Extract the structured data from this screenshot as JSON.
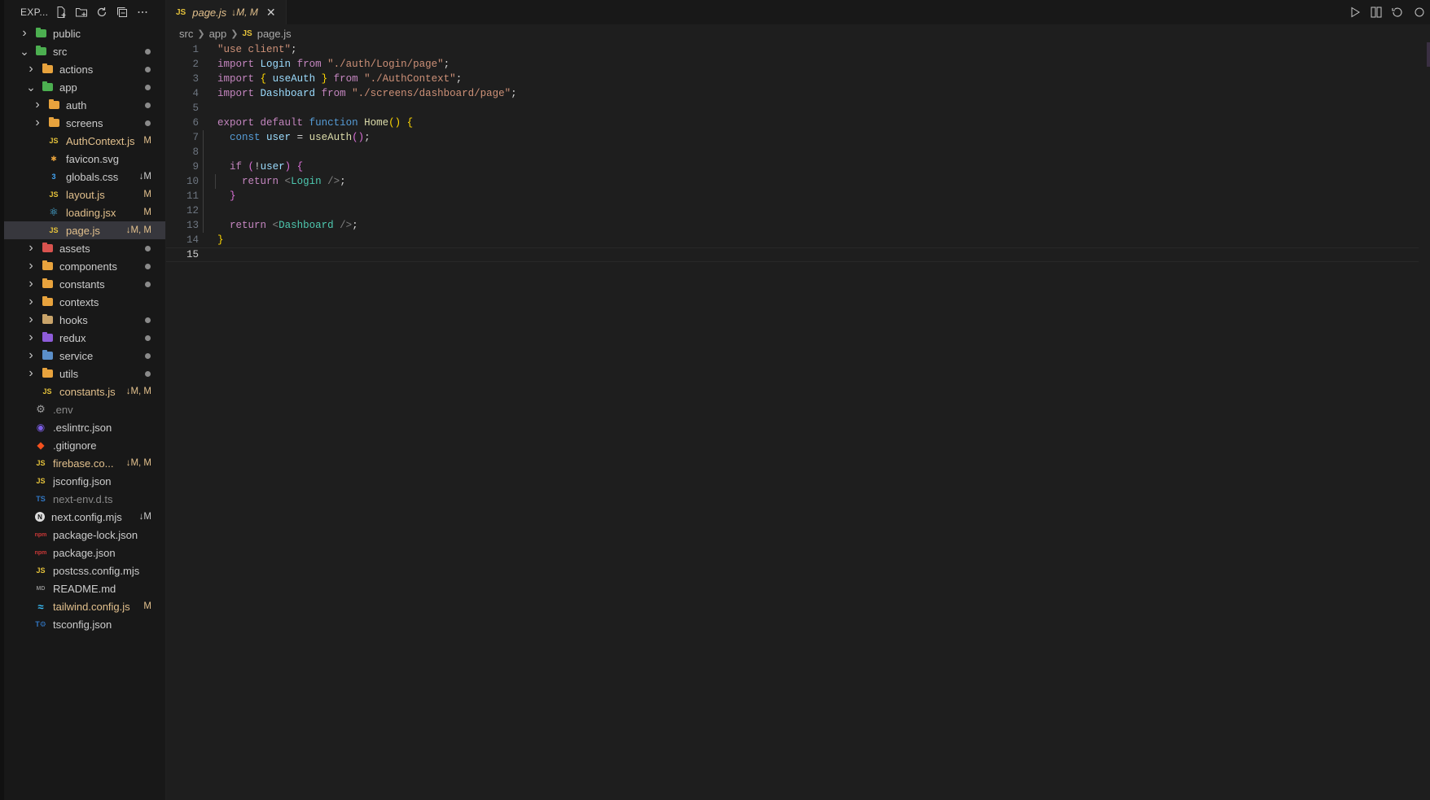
{
  "sidebar": {
    "title": "EXP...",
    "actions": [
      "new-file-icon",
      "new-folder-icon",
      "refresh-icon",
      "collapse-all-icon",
      "more-icon"
    ],
    "items": [
      {
        "name": "public",
        "depth": 0,
        "kind": "folder",
        "expanded": false,
        "color": "#4caf50",
        "badge": "",
        "dot": false
      },
      {
        "name": "src",
        "depth": 0,
        "kind": "folder",
        "expanded": true,
        "color": "#4caf50",
        "badge": "",
        "dot": true
      },
      {
        "name": "actions",
        "depth": 1,
        "kind": "folder",
        "expanded": false,
        "color": "#e8a33d",
        "badge": "",
        "dot": true
      },
      {
        "name": "app",
        "depth": 1,
        "kind": "folder",
        "expanded": true,
        "color": "#4caf50",
        "badge": "",
        "dot": true
      },
      {
        "name": "auth",
        "depth": 2,
        "kind": "folder",
        "expanded": false,
        "color": "#e8a33d",
        "badge": "",
        "dot": true
      },
      {
        "name": "screens",
        "depth": 2,
        "kind": "folder",
        "expanded": false,
        "color": "#e8a33d",
        "badge": "",
        "dot": true
      },
      {
        "name": "AuthContext.js",
        "depth": 2,
        "kind": "js",
        "badge": "M",
        "modified": true,
        "dot": false
      },
      {
        "name": "favicon.svg",
        "depth": 2,
        "kind": "svg",
        "badge": "",
        "modified": false,
        "dot": false
      },
      {
        "name": "globals.css",
        "depth": 2,
        "kind": "css",
        "badge": "↓M",
        "modified": false,
        "dot": false
      },
      {
        "name": "layout.js",
        "depth": 2,
        "kind": "js",
        "badge": "M",
        "modified": true,
        "dot": false
      },
      {
        "name": "loading.jsx",
        "depth": 2,
        "kind": "react",
        "badge": "M",
        "modified": true,
        "dot": false
      },
      {
        "name": "page.js",
        "depth": 2,
        "kind": "js",
        "badge": "↓M, M",
        "modified": true,
        "dot": false,
        "selected": true
      },
      {
        "name": "assets",
        "depth": 1,
        "kind": "folder",
        "expanded": false,
        "color": "#d9534f",
        "badge": "",
        "dot": true
      },
      {
        "name": "components",
        "depth": 1,
        "kind": "folder",
        "expanded": false,
        "color": "#e8a33d",
        "badge": "",
        "dot": true
      },
      {
        "name": "constants",
        "depth": 1,
        "kind": "folder",
        "expanded": false,
        "color": "#e8a33d",
        "badge": "",
        "dot": true
      },
      {
        "name": "contexts",
        "depth": 1,
        "kind": "folder",
        "expanded": false,
        "color": "#e8a33d",
        "badge": "",
        "dot": false
      },
      {
        "name": "hooks",
        "depth": 1,
        "kind": "folder",
        "expanded": false,
        "color": "#c9a46a",
        "badge": "",
        "dot": true
      },
      {
        "name": "redux",
        "depth": 1,
        "kind": "folder",
        "expanded": false,
        "color": "#8e5cd9",
        "badge": "",
        "dot": true
      },
      {
        "name": "service",
        "depth": 1,
        "kind": "folder",
        "expanded": false,
        "color": "#5b8fc9",
        "badge": "",
        "dot": true
      },
      {
        "name": "utils",
        "depth": 1,
        "kind": "folder",
        "expanded": false,
        "color": "#e8a33d",
        "badge": "",
        "dot": true
      },
      {
        "name": "constants.js",
        "depth": 1,
        "kind": "js",
        "badge": "↓M, M",
        "modified": true,
        "dot": false
      },
      {
        "name": ".env",
        "depth": 0,
        "kind": "gear",
        "badge": "",
        "modified": false,
        "dim": true,
        "dot": false
      },
      {
        "name": ".eslintrc.json",
        "depth": 0,
        "kind": "eslint",
        "badge": "",
        "modified": false,
        "dot": false
      },
      {
        "name": ".gitignore",
        "depth": 0,
        "kind": "git",
        "badge": "",
        "modified": false,
        "dot": false
      },
      {
        "name": "firebase.co...",
        "depth": 0,
        "kind": "js",
        "badge": "↓M, M",
        "modified": true,
        "dot": false
      },
      {
        "name": "jsconfig.json",
        "depth": 0,
        "kind": "js",
        "badge": "",
        "modified": false,
        "dot": false
      },
      {
        "name": "next-env.d.ts",
        "depth": 0,
        "kind": "ts",
        "badge": "",
        "modified": false,
        "dim": true,
        "dot": false
      },
      {
        "name": "next.config.mjs",
        "depth": 0,
        "kind": "next",
        "badge": "↓M",
        "modified": false,
        "dot": false
      },
      {
        "name": "package-lock.json",
        "depth": 0,
        "kind": "npm",
        "badge": "",
        "modified": false,
        "dot": false
      },
      {
        "name": "package.json",
        "depth": 0,
        "kind": "npm",
        "badge": "",
        "modified": false,
        "dot": false
      },
      {
        "name": "postcss.config.mjs",
        "depth": 0,
        "kind": "js",
        "badge": "",
        "modified": false,
        "dot": false
      },
      {
        "name": "README.md",
        "depth": 0,
        "kind": "md",
        "badge": "",
        "modified": false,
        "dot": false
      },
      {
        "name": "tailwind.config.js",
        "depth": 0,
        "kind": "tailwind",
        "badge": "M",
        "modified": true,
        "dot": false
      },
      {
        "name": "tsconfig.json",
        "depth": 0,
        "kind": "tsconfig",
        "badge": "",
        "modified": false,
        "dot": false
      }
    ]
  },
  "tab": {
    "icon": "JS",
    "name": "page.js",
    "badge": "↓M, M"
  },
  "breadcrumb": {
    "parts": [
      "src",
      "app"
    ],
    "file_icon": "JS",
    "file": "page.js"
  },
  "editor_actions": [
    "run-icon",
    "compare-icon",
    "revert-icon",
    "split-icon"
  ],
  "code": {
    "active_line": 15,
    "lines": [
      [
        [
          "\"use client\"",
          "str"
        ],
        [
          ";",
          "plain"
        ]
      ],
      [
        [
          "import",
          "kw"
        ],
        [
          " ",
          "plain"
        ],
        [
          "Login",
          "var"
        ],
        [
          " ",
          "plain"
        ],
        [
          "from",
          "kw"
        ],
        [
          " ",
          "plain"
        ],
        [
          "\"./auth/Login/page\"",
          "str"
        ],
        [
          ";",
          "plain"
        ]
      ],
      [
        [
          "import",
          "kw"
        ],
        [
          " ",
          "plain"
        ],
        [
          "{",
          "b1"
        ],
        [
          " ",
          "plain"
        ],
        [
          "useAuth",
          "var"
        ],
        [
          " ",
          "plain"
        ],
        [
          "}",
          "b1"
        ],
        [
          " ",
          "plain"
        ],
        [
          "from",
          "kw"
        ],
        [
          " ",
          "plain"
        ],
        [
          "\"./AuthContext\"",
          "str"
        ],
        [
          ";",
          "plain"
        ]
      ],
      [
        [
          "import",
          "kw"
        ],
        [
          " ",
          "plain"
        ],
        [
          "Dashboard",
          "var"
        ],
        [
          " ",
          "plain"
        ],
        [
          "from",
          "kw"
        ],
        [
          " ",
          "plain"
        ],
        [
          "\"./screens/dashboard/page\"",
          "str"
        ],
        [
          ";",
          "plain"
        ]
      ],
      [],
      [
        [
          "export",
          "kw"
        ],
        [
          " ",
          "plain"
        ],
        [
          "default",
          "kw"
        ],
        [
          " ",
          "plain"
        ],
        [
          "function",
          "decl"
        ],
        [
          " ",
          "plain"
        ],
        [
          "Home",
          "fn"
        ],
        [
          "()",
          "b1"
        ],
        [
          " ",
          "plain"
        ],
        [
          "{",
          "b1"
        ]
      ],
      [
        [
          "  ",
          "plain"
        ],
        [
          "const",
          "decl"
        ],
        [
          " ",
          "plain"
        ],
        [
          "user",
          "var"
        ],
        [
          " = ",
          "plain"
        ],
        [
          "useAuth",
          "fn"
        ],
        [
          "()",
          "b2"
        ],
        [
          ";",
          "plain"
        ]
      ],
      [],
      [
        [
          "  ",
          "plain"
        ],
        [
          "if",
          "kw"
        ],
        [
          " ",
          "plain"
        ],
        [
          "(",
          "b2"
        ],
        [
          "!",
          "plain"
        ],
        [
          "user",
          "var"
        ],
        [
          ")",
          "b2"
        ],
        [
          " ",
          "plain"
        ],
        [
          "{",
          "b2"
        ]
      ],
      [
        [
          "    ",
          "plain"
        ],
        [
          "return",
          "kw"
        ],
        [
          " ",
          "plain"
        ],
        [
          "<",
          "punct"
        ],
        [
          "Login",
          "tag"
        ],
        [
          " ",
          "plain"
        ],
        [
          "/>",
          "punct"
        ],
        [
          ";",
          "plain"
        ]
      ],
      [
        [
          "  ",
          "plain"
        ],
        [
          "}",
          "b2"
        ]
      ],
      [],
      [
        [
          "  ",
          "plain"
        ],
        [
          "return",
          "kw"
        ],
        [
          " ",
          "plain"
        ],
        [
          "<",
          "punct"
        ],
        [
          "Dashboard",
          "tag"
        ],
        [
          " ",
          "plain"
        ],
        [
          "/>",
          "punct"
        ],
        [
          ";",
          "plain"
        ]
      ],
      [
        [
          "}",
          "b1"
        ]
      ],
      []
    ]
  }
}
